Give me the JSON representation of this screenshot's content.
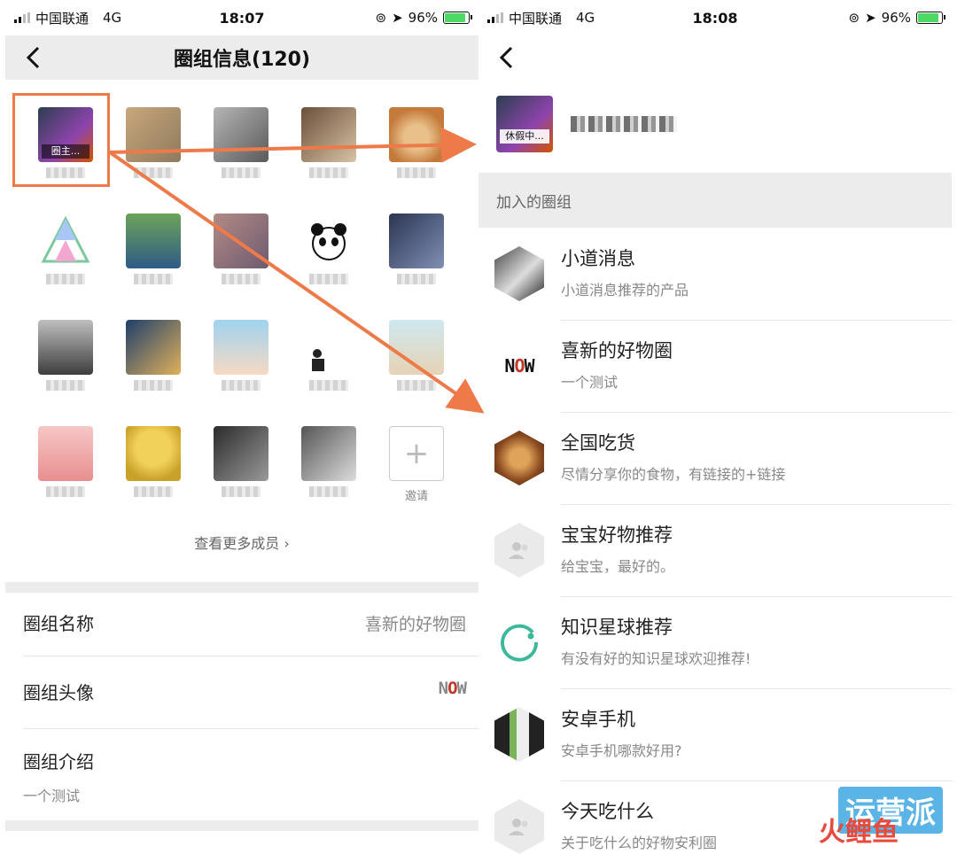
{
  "left": {
    "status": {
      "carrier": "中国联通",
      "network": "4G",
      "time": "18:07",
      "battery": "96%"
    },
    "title": "圈组信息(120)",
    "owner_tag": "圈主...",
    "invite_label": "邀请",
    "more_members": "查看更多成员",
    "rows": {
      "name_label": "圈组名称",
      "name_value": "喜新的好物圈",
      "avatar_label": "圈组头像",
      "intro_label": "圈组介绍",
      "intro_value": "一个测试"
    }
  },
  "right": {
    "status": {
      "carrier": "中国联通",
      "network": "4G",
      "time": "18:08",
      "battery": "96%"
    },
    "profile_tag": "休假中...",
    "section_header": "加入的圈组",
    "groups": [
      {
        "title": "小道消息",
        "subtitle": "小道消息推荐的产品"
      },
      {
        "title": "喜新的好物圈",
        "subtitle": "一个测试"
      },
      {
        "title": "全国吃货",
        "subtitle": "尽情分享你的食物，有链接的+链接"
      },
      {
        "title": "宝宝好物推荐",
        "subtitle": "给宝宝，最好的。"
      },
      {
        "title": "知识星球推荐",
        "subtitle": "有没有好的知识星球欢迎推荐!"
      },
      {
        "title": "安卓手机",
        "subtitle": "安卓手机哪款好用?"
      },
      {
        "title": "今天吃什么",
        "subtitle": "关于吃什么的好物安利圈"
      }
    ]
  },
  "logo": {
    "n": "N",
    "o": "O",
    "w": "W"
  },
  "watermark": {
    "line1": "运营派",
    "line2": "火鲤鱼"
  },
  "colors": {
    "accent": "#ee7a4a",
    "band": "#ececec",
    "battery": "#4cd964"
  }
}
